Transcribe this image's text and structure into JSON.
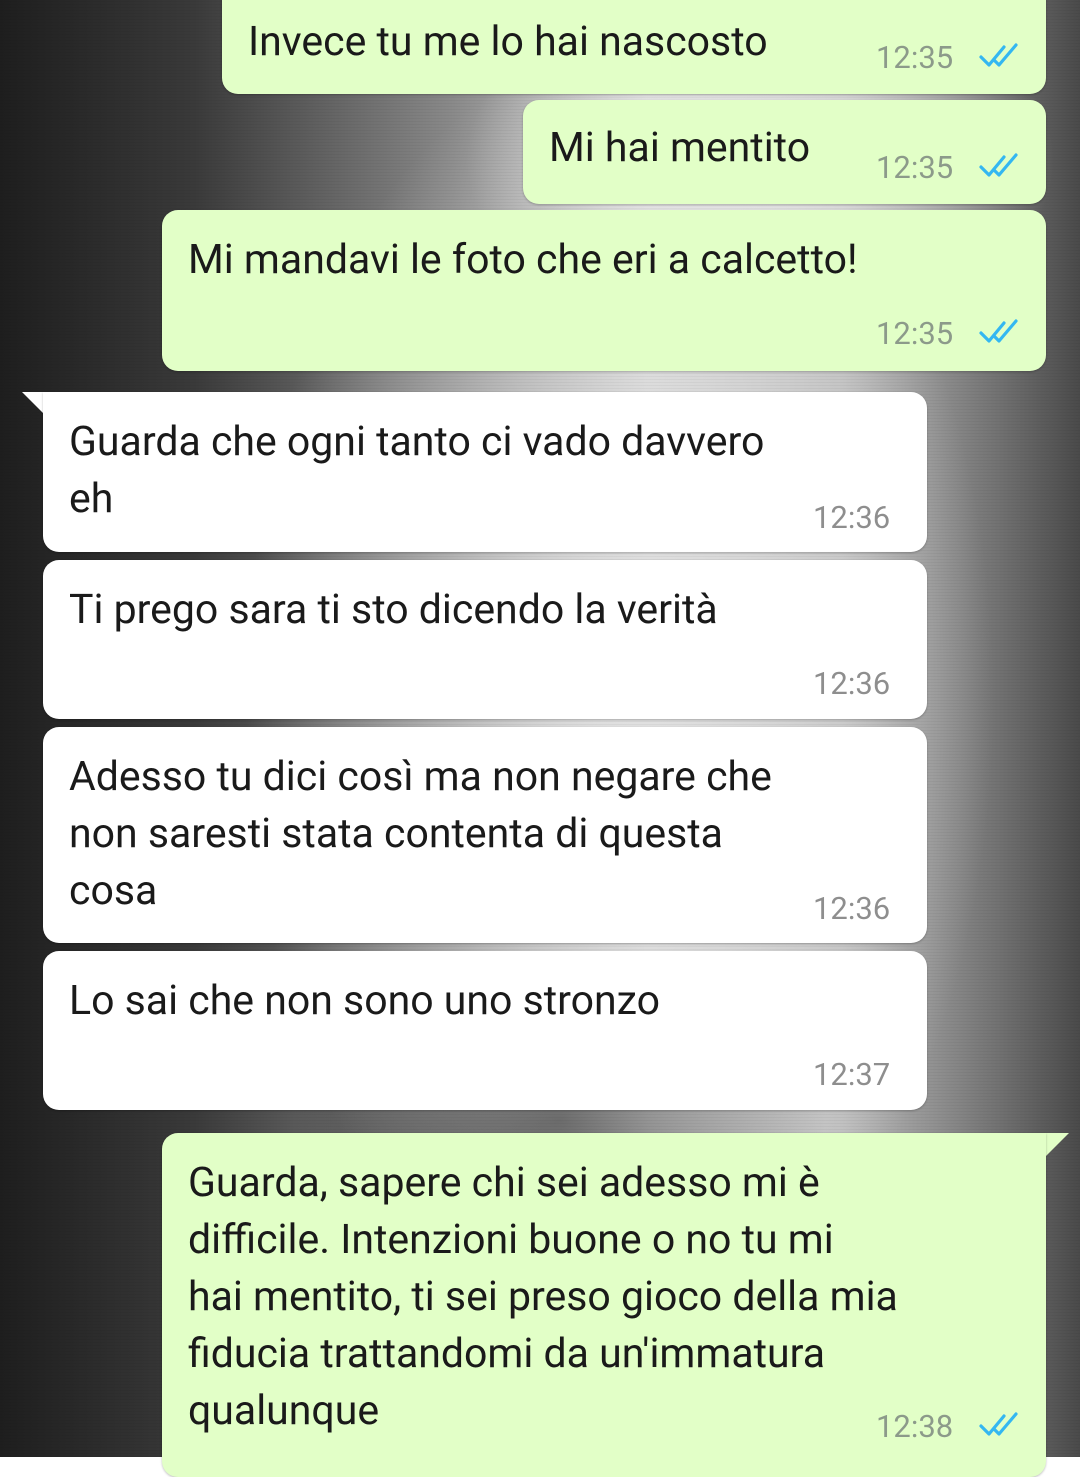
{
  "colors": {
    "outgoing_bubble": "#e2ffc7",
    "incoming_bubble": "#ffffff",
    "read_ticks": "#34b7f1"
  },
  "messages": [
    {
      "direction": "outgoing",
      "text": "Invece tu me lo hai nascosto",
      "time": "12:35",
      "status": "read"
    },
    {
      "direction": "outgoing",
      "text": "Mi hai mentito",
      "time": "12:35",
      "status": "read"
    },
    {
      "direction": "outgoing",
      "text": "Mi mandavi le foto che eri a calcetto!",
      "time": "12:35",
      "status": "read"
    },
    {
      "direction": "incoming",
      "text": "Guarda che ogni tanto ci vado davvero\neh",
      "time": "12:36"
    },
    {
      "direction": "incoming",
      "text": "Ti prego sara ti sto dicendo la verità",
      "time": "12:36"
    },
    {
      "direction": "incoming",
      "text": "Adesso tu dici così ma non negare che\nnon saresti stata contenta di questa\ncosa",
      "time": "12:36"
    },
    {
      "direction": "incoming",
      "text": "Lo sai che non sono uno stronzo",
      "time": "12:37"
    },
    {
      "direction": "outgoing",
      "text": "Guarda, sapere chi sei adesso mi è\ndifficile. Intenzioni buone o no tu mi\nhai mentito, ti sei preso gioco della mia\nfiducia trattandomi da un'immatura\nqualunque",
      "time": "12:38",
      "status": "read"
    }
  ]
}
